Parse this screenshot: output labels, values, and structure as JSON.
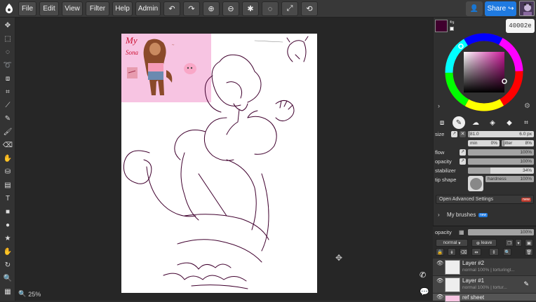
{
  "menu": {
    "file": "File",
    "edit": "Edit",
    "view": "View",
    "filter": "Filter",
    "help": "Help",
    "admin": "Admin",
    "share": "Share"
  },
  "color": {
    "hex": "40002e",
    "current_color": "#40002e"
  },
  "brush": {
    "size_label": "size",
    "size_value": "81.0",
    "size_px": "6.0 px",
    "min_label": "min",
    "min_value": "0%",
    "jitter_label": "jitter",
    "jitter_value": "8%",
    "flow_label": "flow",
    "flow_value": "100%",
    "flow_level": 100,
    "opacity_label": "opacity",
    "opacity_value": "100%",
    "opacity_level": 100,
    "stabilizer_label": "stabilizer",
    "stabilizer_value": "34%",
    "stabilizer_level": 34,
    "tip_shape_label": "tip shape",
    "hardness_label": "hardness",
    "hardness_value": "100%",
    "hardness_level": 100,
    "advanced_label": "Open Advanced Settings",
    "advanced_badge": "new",
    "my_brushes_label": "My brushes",
    "my_brushes_badge": "new"
  },
  "layers": {
    "opacity_label": "opacity",
    "opacity_value": "100%",
    "blend_mode": "normal",
    "leave_label": "leave",
    "items": [
      {
        "name": "Layer #2",
        "sub": "normal 100% | torturingt..."
      },
      {
        "name": "Layer #1",
        "sub": "normal 100% | tortur..."
      },
      {
        "name": "ref sheet",
        "sub": ""
      }
    ]
  },
  "canvas": {
    "zoom": "25%",
    "ref_text_my": "My",
    "ref_text_sona": "Sona"
  }
}
